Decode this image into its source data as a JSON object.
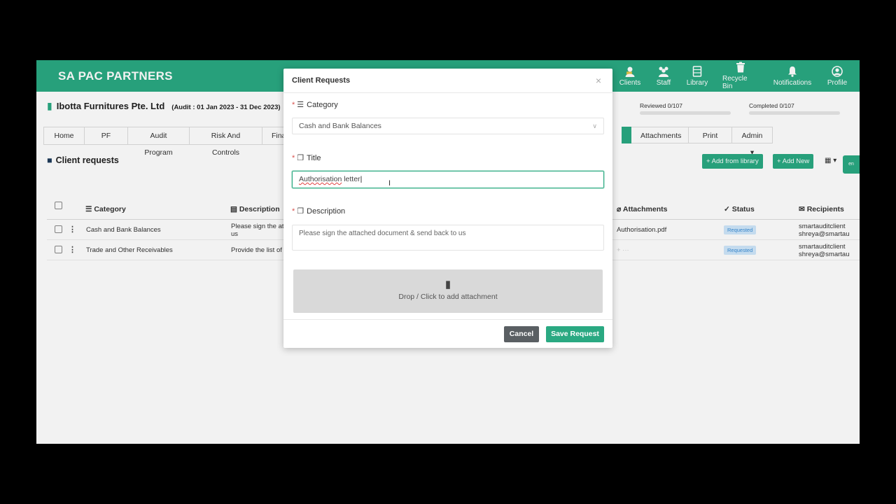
{
  "app": {
    "brand": "SA PAC PARTNERS",
    "nav": [
      {
        "icon": "clients-icon",
        "label": "Clients"
      },
      {
        "icon": "staff-icon",
        "label": "Staff"
      },
      {
        "icon": "library-icon",
        "label": "Library"
      },
      {
        "icon": "recycle-bin-icon",
        "label": "Recycle Bin"
      },
      {
        "icon": "bell-icon",
        "label": "Notifications"
      },
      {
        "icon": "profile-icon",
        "label": "Profile"
      }
    ],
    "colors": {
      "accent": "#2aa982",
      "badge_bg": "#cfe7fb",
      "badge_text": "#3b8ed6"
    }
  },
  "client": {
    "name": "Ibotta Furnitures Pte. Ltd",
    "audit": "(Audit : 01 Jan 2023 - 31 Dec 2023)",
    "reviewed": "Reviewed 0/107",
    "completed": "Completed 0/107"
  },
  "tabs": [
    "Home",
    "PF",
    "Audit Program",
    "Risk And Controls",
    "Fina"
  ],
  "tabs_right": [
    "Attachments",
    "Print",
    "Admin ▾"
  ],
  "page": {
    "section_title": "Client requests",
    "add_from_library": "+ Add from library",
    "add_new": "+ Add New",
    "lang": "en"
  },
  "table": {
    "columns": {
      "category": "Category",
      "description": "Description",
      "attachments": "Attachments",
      "status": "Status",
      "recipients": "Recipients"
    },
    "rows": [
      {
        "category": "Cash and Bank Balances",
        "description_l1": "Please sign the at",
        "description_l2": "us",
        "attachment": "Authorisation.pdf",
        "status": "Requested",
        "recipient_l1": "smartauditclient",
        "recipient_l2": "shreya@smartau"
      },
      {
        "category": "Trade and Other Receivables",
        "description_l1": "Provide the list of",
        "description_l2": "",
        "attachment": "",
        "status": "Requested",
        "recipient_l1": "smartauditclient",
        "recipient_l2": "shreya@smartau"
      }
    ]
  },
  "modal": {
    "title": "Client Requests",
    "close": "×",
    "category_label": "Category",
    "category_value": "Cash and Bank Balances",
    "title_label": "Title",
    "title_value_spell": "Authorisation",
    "title_value_rest": " letter",
    "description_label": "Description",
    "description_value": "Please sign the attached document & send back to us",
    "drop_text": "Drop / Click to add attachment",
    "cancel": "Cancel",
    "save": "Save Request"
  }
}
